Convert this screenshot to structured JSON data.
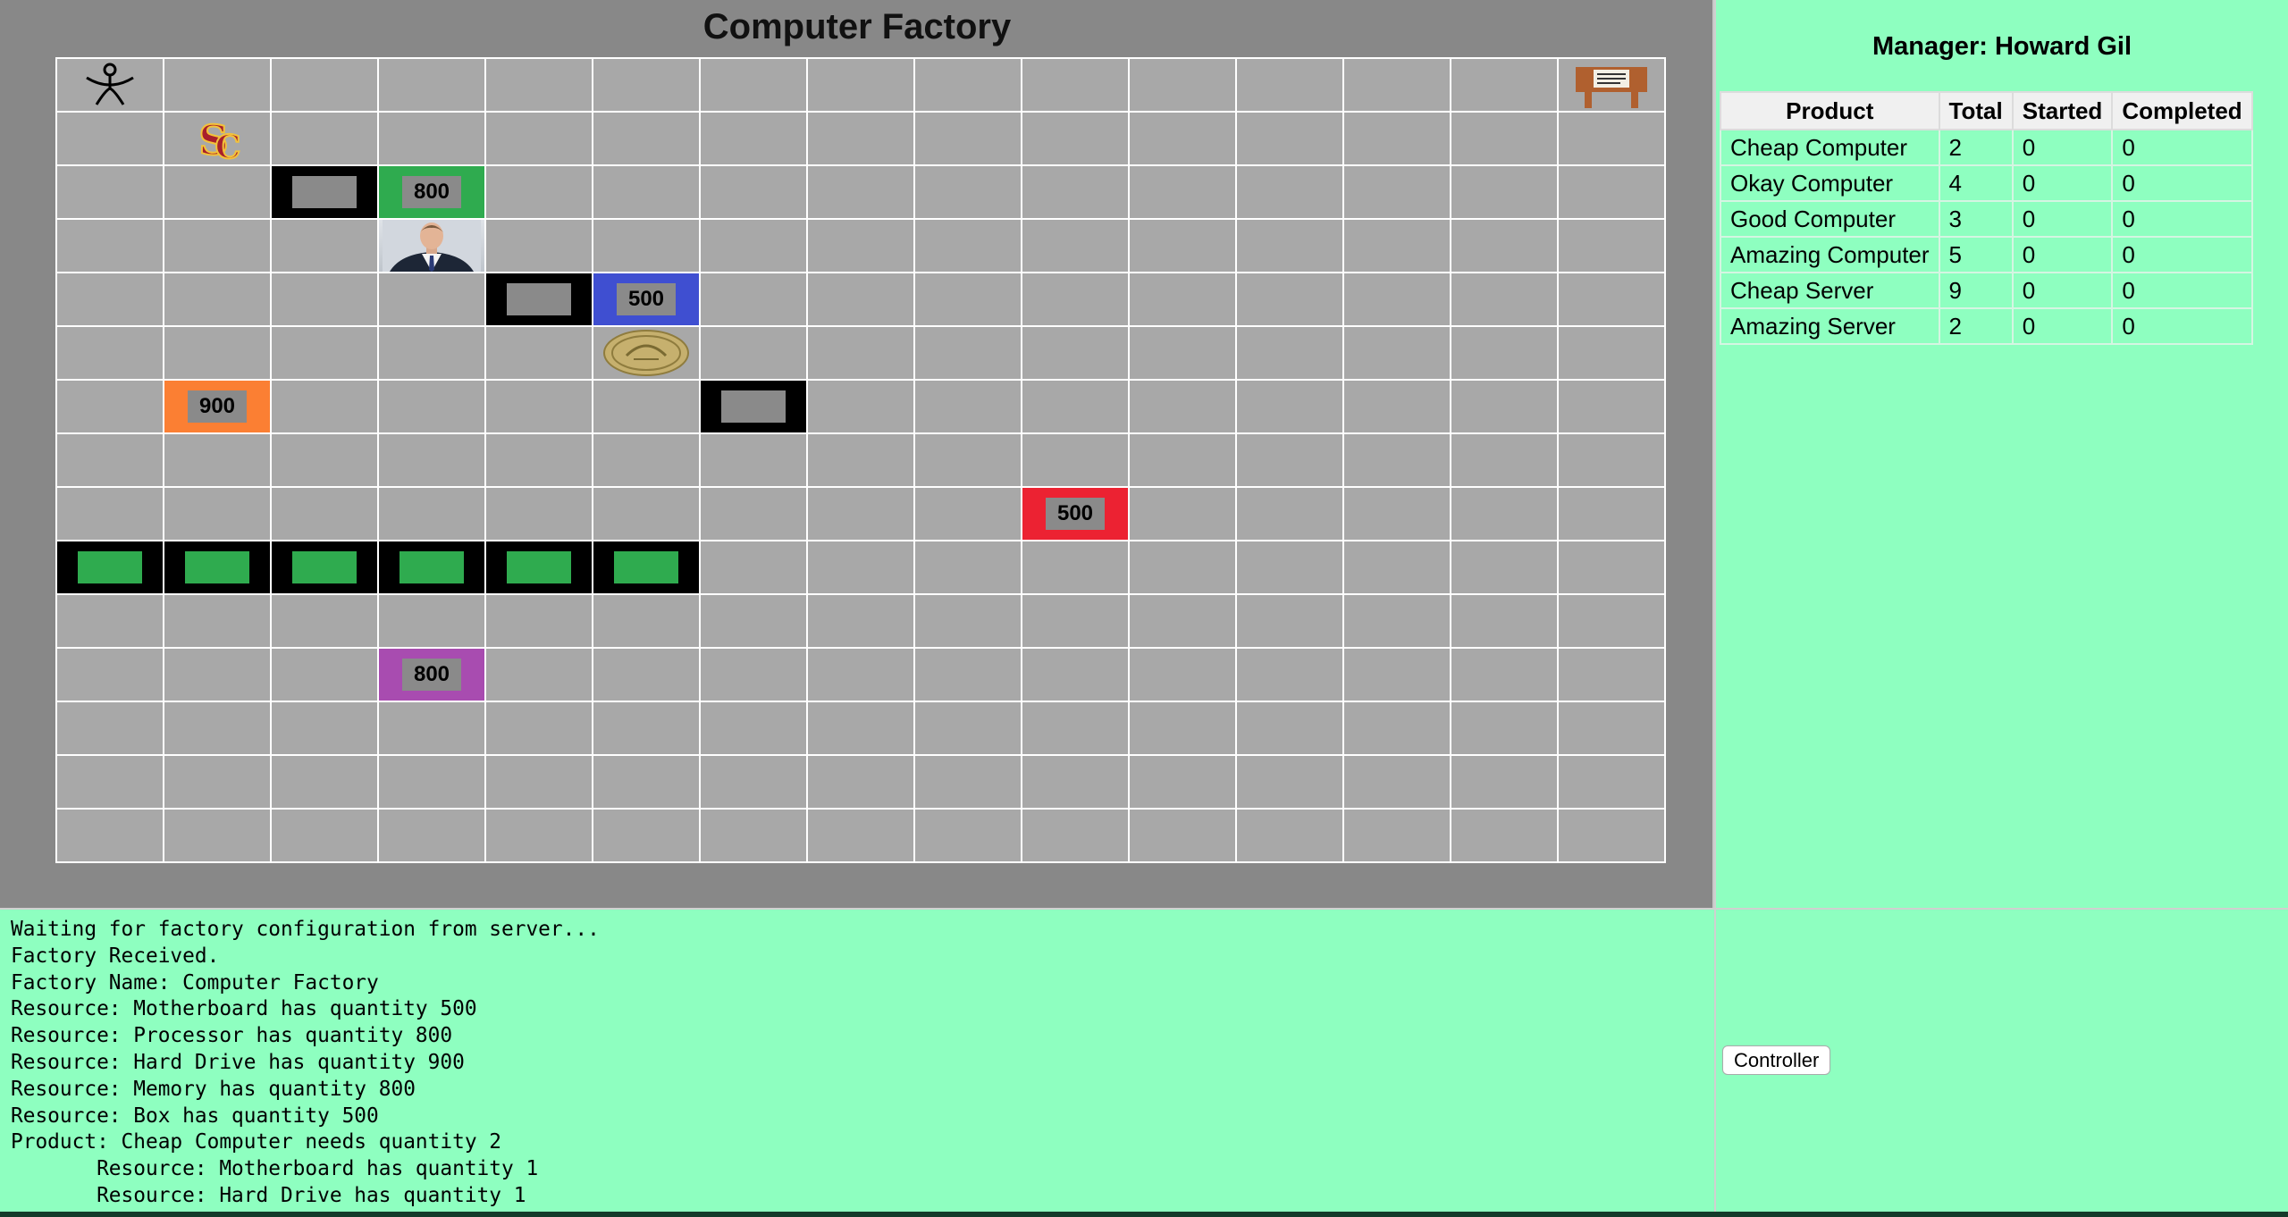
{
  "factory": {
    "title": "Computer Factory",
    "cells": [
      {
        "r": 0,
        "c": 0,
        "kind": "icon",
        "icon": "stick-figure-worker-icon"
      },
      {
        "r": 0,
        "c": 14,
        "kind": "icon",
        "icon": "taskboard-sign-icon"
      },
      {
        "r": 1,
        "c": 1,
        "kind": "icon",
        "icon": "usc-logo-icon"
      },
      {
        "r": 2,
        "c": 2,
        "kind": "workbench",
        "bg": "black",
        "inner": "grey"
      },
      {
        "r": 2,
        "c": 3,
        "kind": "resource",
        "bg": "green",
        "qty": "800"
      },
      {
        "r": 3,
        "c": 3,
        "kind": "icon",
        "icon": "manager-photo-icon"
      },
      {
        "r": 4,
        "c": 4,
        "kind": "workbench",
        "bg": "black",
        "inner": "grey"
      },
      {
        "r": 4,
        "c": 5,
        "kind": "resource",
        "bg": "blue",
        "qty": "500"
      },
      {
        "r": 5,
        "c": 5,
        "kind": "icon",
        "icon": "gold-coin-seal-icon"
      },
      {
        "r": 6,
        "c": 1,
        "kind": "resource",
        "bg": "orange",
        "qty": "900"
      },
      {
        "r": 6,
        "c": 6,
        "kind": "workbench",
        "bg": "black",
        "inner": "grey"
      },
      {
        "r": 8,
        "c": 9,
        "kind": "resource",
        "bg": "red",
        "qty": "500"
      },
      {
        "r": 9,
        "c": 0,
        "kind": "workbench",
        "bg": "black",
        "inner": "green"
      },
      {
        "r": 9,
        "c": 1,
        "kind": "workbench",
        "bg": "black",
        "inner": "green"
      },
      {
        "r": 9,
        "c": 2,
        "kind": "workbench",
        "bg": "black",
        "inner": "green"
      },
      {
        "r": 9,
        "c": 3,
        "kind": "workbench",
        "bg": "black",
        "inner": "green"
      },
      {
        "r": 9,
        "c": 4,
        "kind": "workbench",
        "bg": "black",
        "inner": "green"
      },
      {
        "r": 9,
        "c": 5,
        "kind": "workbench",
        "bg": "black",
        "inner": "green"
      },
      {
        "r": 11,
        "c": 3,
        "kind": "resource",
        "bg": "purple",
        "qty": "800"
      }
    ]
  },
  "manager": {
    "title": "Manager: Howard Gil",
    "columns": [
      "Product",
      "Total",
      "Started",
      "Completed"
    ],
    "rows": [
      [
        "Cheap Computer",
        "2",
        "0",
        "0"
      ],
      [
        "Okay Computer",
        "4",
        "0",
        "0"
      ],
      [
        "Good Computer",
        "3",
        "0",
        "0"
      ],
      [
        "Amazing Computer",
        "5",
        "0",
        "0"
      ],
      [
        "Cheap Server",
        "9",
        "0",
        "0"
      ],
      [
        "Amazing Server",
        "2",
        "0",
        "0"
      ]
    ]
  },
  "log": {
    "lines": [
      "Waiting for factory configuration from server...",
      "Factory Received.",
      "Factory Name: Computer Factory",
      "Resource: Motherboard has quantity 500",
      "Resource: Processor has quantity 800",
      "Resource: Hard Drive has quantity 900",
      "Resource: Memory has quantity 800",
      "Resource: Box has quantity 500",
      "Product: Cheap Computer needs quantity 2",
      "       Resource: Motherboard has quantity 1",
      "       Resource: Hard Drive has quantity 1"
    ]
  },
  "controls": {
    "controller_label": "Controller"
  },
  "colors": {
    "panel_green": "#8effc0",
    "factory_bg": "#888888",
    "cell_grey": "#a8a8a8",
    "green": "#2fab4f",
    "blue": "#3f4fd1",
    "orange": "#fb7f33",
    "red": "#ec2232",
    "purple": "#a84cb0"
  }
}
